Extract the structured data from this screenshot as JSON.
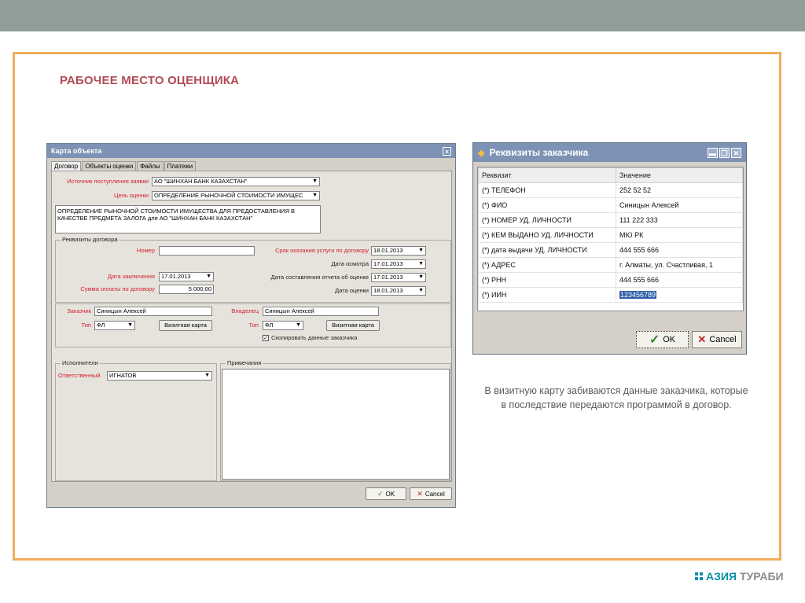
{
  "slide": {
    "title": "РАБОЧЕЕ МЕСТО ОЦЕНЩИКА",
    "caption": "В визитную карту забиваются данные заказчика, которые в последствие передаются программой в договор.",
    "brand_part1": "АЗИЯ",
    "brand_part2": "ТУРАБИ"
  },
  "object_card": {
    "title": "Карта объекта",
    "close": "×",
    "tabs": [
      "Договор",
      "Объекты оценки",
      "Файлы",
      "Платежи"
    ],
    "source_label": "Источник поступления заявки",
    "source_value": "АО \"ШИНХАН БАНК КАЗАХСТАН\"",
    "purpose_label": "Цель оценки",
    "purpose_value": "ОПРЕДЕЛЕНИЕ РЫНОЧНОЙ СТОИМОСТИ ИМУЩЕС",
    "purpose_text": "ОПРЕДЕЛЕНИЕ РЫНОЧНОЙ СТОИМОСТИ ИМУЩЕСТВА ДЛЯ ПРЕДОСТАВЛЕНИЯ В КАЧЕСТВЕ ПРЕДМЕТА ЗАЛОГА для АО \"ШИНХАН БАНК КАЗАХСТАН\"",
    "contract_group": "Реквизиты договора",
    "number_label": "Номер",
    "number_value": "",
    "date_label": "Дата заключения",
    "date_value": "17.01.2013",
    "sum_label": "Сумма оплаты по договору",
    "sum_value": "5 000,00",
    "term_label": "Срок оказания услуги по договору",
    "term_value": "18.01.2013",
    "inspect_label": "Дата осмотра",
    "inspect_value": "17.01.2013",
    "report_label": "Дата составления отчета об оценке",
    "report_value": "17.01.2013",
    "eval_label": "Дата оценки",
    "eval_value": "18.01.2013",
    "customer_label": "Заказчик",
    "customer_value": "Синицын Алексей",
    "owner_label": "Владелец",
    "owner_value": "Синицын Алексей",
    "type_label": "Тип",
    "type_value": "ФЛ",
    "card_button": "Визитная карта",
    "copy_label": "Скопировать данные заказчика",
    "executors_group": "Исполнители",
    "responsible_label": "Ответственный",
    "responsible_value": "ИГНАТОВ",
    "notes_group": "Примечания",
    "ok": "OK",
    "cancel": "Cancel"
  },
  "customer_dialog": {
    "title": "Реквизиты заказчика",
    "columns": [
      "Реквизит",
      "Значение"
    ],
    "rows": [
      [
        "(*) ТЕЛЕФОН",
        "252 52 52"
      ],
      [
        "(*) ФИО",
        "Синицын Алексей"
      ],
      [
        "(*) НОМЕР УД. ЛИЧНОСТИ",
        "111 222 333"
      ],
      [
        "(*) КЕМ ВЫДАНО УД. ЛИЧНОСТИ",
        "МЮ РК"
      ],
      [
        "(*) дата выдачи УД. ЛИЧНОСТИ",
        "444 555 666"
      ],
      [
        "(*) АДРЕС",
        "г. Алматы, ул. Счастливая, 1"
      ],
      [
        "(*) РНН",
        "444 555 666"
      ],
      [
        "(*) ИИН",
        "123456789"
      ]
    ],
    "ok": "OK",
    "cancel": "Cancel"
  }
}
